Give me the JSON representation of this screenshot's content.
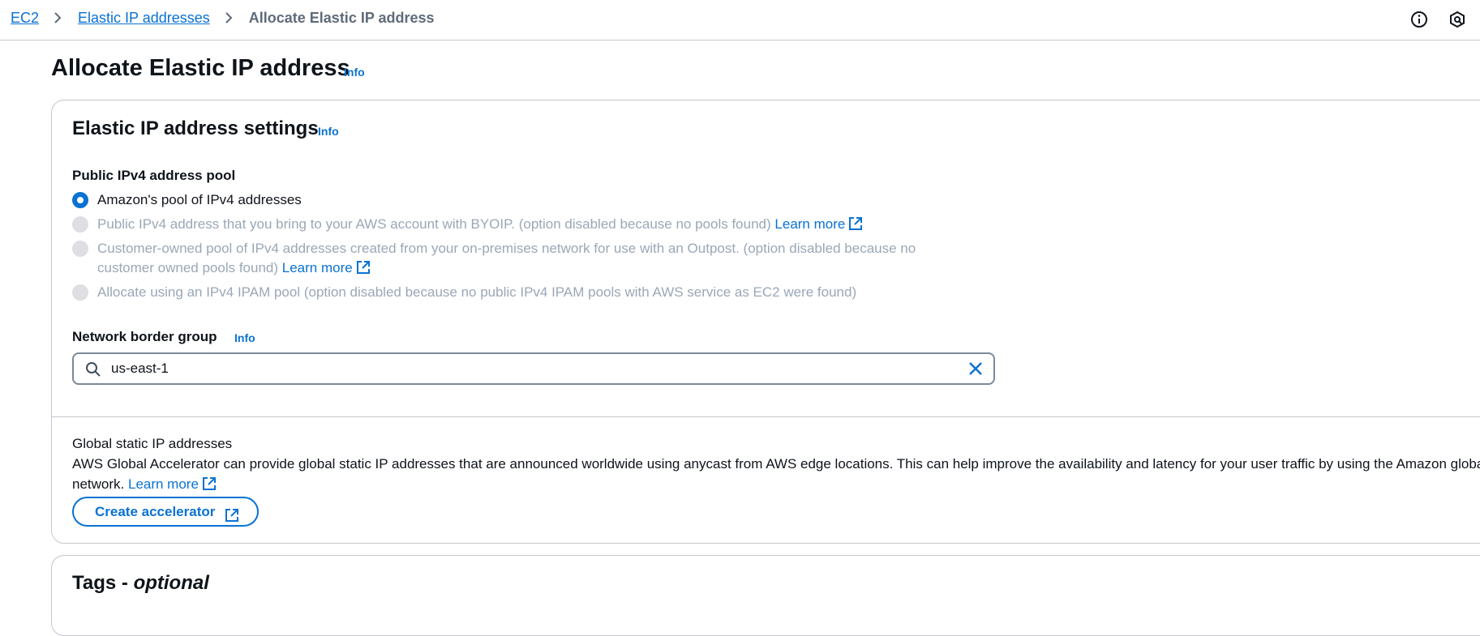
{
  "breadcrumb": {
    "items": [
      "EC2",
      "Elastic IP addresses"
    ],
    "current": "Allocate Elastic IP address"
  },
  "header_icons": [
    "info-circle-icon",
    "notifications-icon"
  ],
  "page": {
    "title": "Allocate Elastic IP address",
    "info_label": "Info"
  },
  "settings": {
    "title": "Elastic IP address settings",
    "info_label": "Info",
    "pool": {
      "label": "Public IPv4 address pool",
      "options": [
        {
          "text": "Amazon's pool of IPv4 addresses",
          "selected": true,
          "disabled": false
        },
        {
          "text": "Public IPv4 address that you bring to your AWS account with BYOIP. (option disabled because no pools found)",
          "link": "Learn more",
          "selected": false,
          "disabled": true
        },
        {
          "text": "Customer-owned pool of IPv4 addresses created from your on-premises network for use with an Outpost. (option disabled because no customer owned pools found)",
          "link": "Learn more",
          "selected": false,
          "disabled": true
        },
        {
          "text": "Allocate using an IPv4 IPAM pool (option disabled because no public IPv4 IPAM pools with AWS service as EC2 were found)",
          "selected": false,
          "disabled": true
        }
      ]
    },
    "network_border_group": {
      "label": "Network border group",
      "info_label": "Info",
      "value": "us-east-1"
    },
    "global_static": {
      "heading": "Global static IP addresses",
      "description": "AWS Global Accelerator can provide global static IP addresses that are announced worldwide using anycast from AWS edge locations. This can help improve the availability and latency for your user traffic by using the Amazon global network.",
      "link": "Learn more",
      "button_label": "Create accelerator"
    }
  },
  "tags": {
    "title": "Tags - ",
    "title_optional": "optional"
  },
  "colors": {
    "link": "#0972d3",
    "text": "#0f141a",
    "disabled_text": "#9ba7b6",
    "border": "#c6c6cd"
  }
}
